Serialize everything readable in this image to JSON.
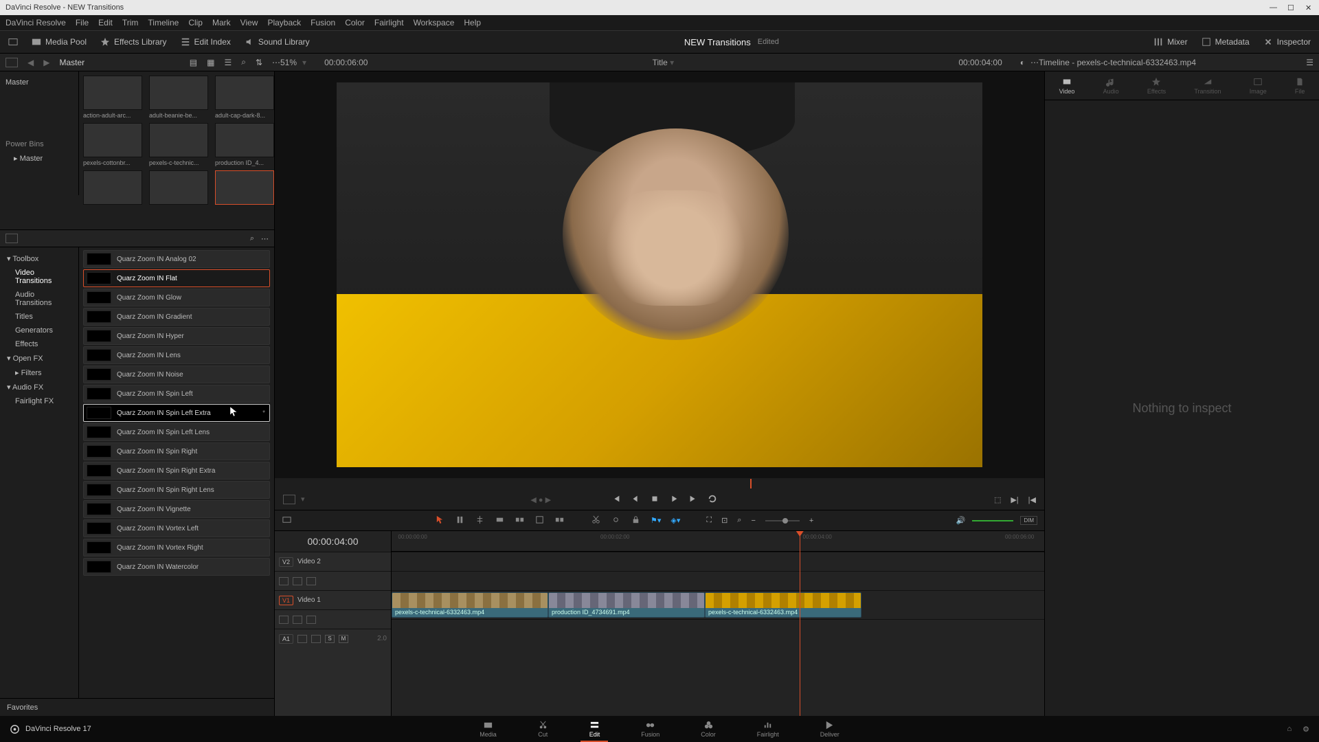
{
  "window_title": "DaVinci Resolve - NEW Transitions",
  "menubar": [
    "DaVinci Resolve",
    "File",
    "Edit",
    "Trim",
    "Timeline",
    "Clip",
    "Mark",
    "View",
    "Playback",
    "Fusion",
    "Color",
    "Fairlight",
    "Workspace",
    "Help"
  ],
  "toolrow": {
    "media_pool": "Media Pool",
    "effects": "Effects Library",
    "edit_index": "Edit Index",
    "sound_library": "Sound Library",
    "project_title": "NEW Transitions",
    "edited": "Edited",
    "mixer": "Mixer",
    "metadata": "Metadata",
    "inspector": "Inspector"
  },
  "infobar": {
    "master": "Master",
    "zoom": "51%",
    "src_tc": "00:00:06:00",
    "title": "Title",
    "rec_tc": "00:00:04:00",
    "timeline_label": "Timeline - pexels-c-technical-6332463.mp4"
  },
  "bin_top": "Master",
  "power_bins": "Power Bins",
  "bin_master": "Master",
  "media": [
    {
      "label": "action-adult-arc..."
    },
    {
      "label": "adult-beanie-be..."
    },
    {
      "label": "adult-cap-dark-8..."
    },
    {
      "label": "pexels-cottonbr..."
    },
    {
      "label": "pexels-c-technic..."
    },
    {
      "label": "production ID_4..."
    },
    {
      "label": ""
    },
    {
      "label": ""
    },
    {
      "label": ""
    }
  ],
  "toolbox": {
    "root": "Toolbox",
    "video_transitions": "Video Transitions",
    "audio_transitions": "Audio Transitions",
    "titles": "Titles",
    "generators": "Generators",
    "effects": "Effects",
    "open_fx": "Open FX",
    "filters": "Filters",
    "audio_fx": "Audio FX",
    "fairlight_fx": "Fairlight FX"
  },
  "transitions": [
    "Quarz Zoom IN Analog 02",
    "Quarz Zoom IN Flat",
    "Quarz Zoom IN Glow",
    "Quarz Zoom IN Gradient",
    "Quarz Zoom IN Hyper",
    "Quarz Zoom IN Lens",
    "Quarz Zoom IN Noise",
    "Quarz Zoom IN Spin Left",
    "Quarz Zoom IN Spin Left Extra",
    "Quarz Zoom IN Spin Left Lens",
    "Quarz Zoom IN Spin Right",
    "Quarz Zoom IN Spin Right Extra",
    "Quarz Zoom IN Spin Right Lens",
    "Quarz Zoom IN Vignette",
    "Quarz Zoom IN Vortex Left",
    "Quarz Zoom IN Vortex Right",
    "Quarz Zoom IN Watercolor"
  ],
  "selected_transition_index": 1,
  "hover_transition_index": 8,
  "favorites": "Favorites",
  "inspector_tabs": [
    "Video",
    "Audio",
    "Effects",
    "Transition",
    "Image",
    "File"
  ],
  "inspector_empty": "Nothing to inspect",
  "timeline": {
    "tc": "00:00:04:00",
    "ruler": [
      "00:00:00:00",
      "00:00:02:00",
      "00:00:04:00",
      "00:00:06:00"
    ],
    "v2": "V2",
    "v2name": "Video 2",
    "v1": "V1",
    "v1name": "Video 1",
    "a1": "A1",
    "a1_20": "2.0",
    "clips": [
      {
        "name": "pexels-c-technical-6332463.mp4"
      },
      {
        "name": "production ID_4734691.mp4"
      },
      {
        "name": "pexels-c-technical-6332463.mp4"
      }
    ]
  },
  "pages": [
    "Media",
    "Cut",
    "Edit",
    "Fusion",
    "Color",
    "Fairlight",
    "Deliver"
  ],
  "active_page_index": 2,
  "brand": "DaVinci Resolve 17"
}
